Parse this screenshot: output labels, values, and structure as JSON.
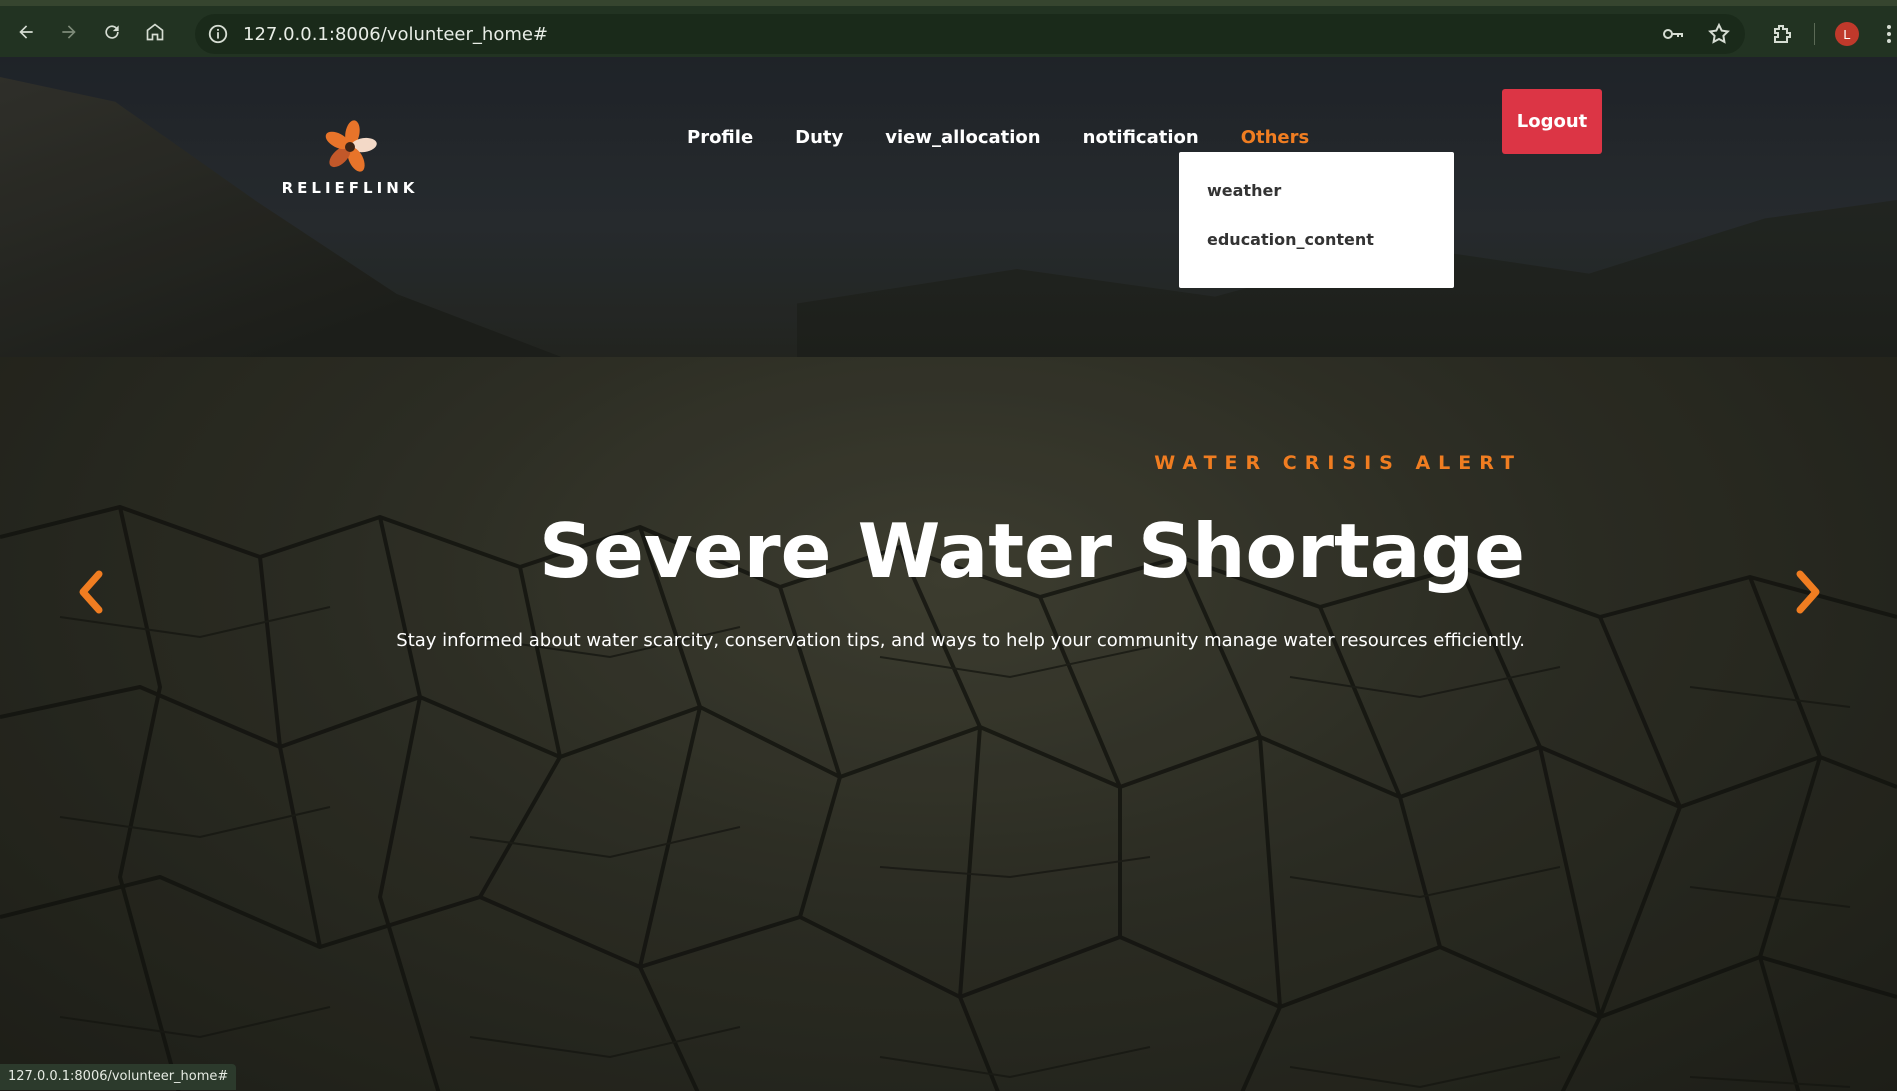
{
  "browser": {
    "url": "127.0.0.1:8006/volunteer_home#",
    "status_url": "127.0.0.1:8006/volunteer_home#",
    "profile_initial": "L",
    "icons": [
      "back-icon",
      "forward-icon",
      "reload-icon",
      "home-icon",
      "info-icon",
      "key-icon",
      "star-icon",
      "extensions-icon",
      "menu-icon"
    ]
  },
  "site": {
    "logo_text": "RELIEFLINK",
    "nav": {
      "profile": "Profile",
      "duty": "Duty",
      "view_allocation": "view_allocation",
      "notification": "notification",
      "others": "Others"
    },
    "logout": "Logout",
    "dropdown": {
      "weather": "weather",
      "education_content": "education_content"
    }
  },
  "hero": {
    "eyebrow": "WATER CRISIS ALERT",
    "title": "Severe Water Shortage",
    "subtitle": "Stay informed about water scarcity, conservation tips, and ways to help your community manage water resources efficiently."
  },
  "colors": {
    "accent": "#f07d21",
    "logout": "#dc3545"
  }
}
